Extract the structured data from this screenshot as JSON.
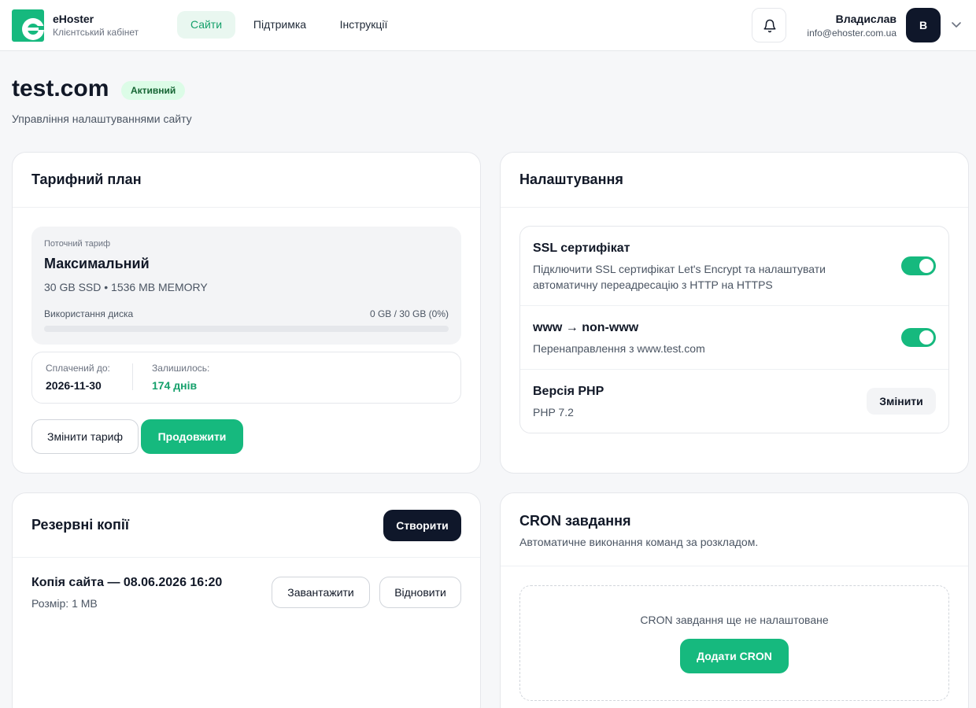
{
  "brand": {
    "name": "eHoster",
    "subtitle": "Клієнтський кабінет"
  },
  "nav": [
    {
      "label": "Сайти",
      "active": true
    },
    {
      "label": "Підтримка",
      "active": false
    },
    {
      "label": "Інструкції",
      "active": false
    }
  ],
  "user": {
    "name": "Владислав",
    "email": "info@ehoster.com.ua",
    "initial": "В"
  },
  "page": {
    "title": "test.com",
    "status": "Активний",
    "subtitle": "Управління налаштуваннями сайту"
  },
  "tariff": {
    "title": "Тарифний план",
    "current_label": "Поточний тариф",
    "plan_name": "Максимальний",
    "specs": "30 GB SSD • 1536 MB MEMORY",
    "disk_label": "Використання диска",
    "disk_value": "0 GB / 30 GB (0%)",
    "disk_usage_fraction": 0,
    "paid_label": "Сплачений до:",
    "paid_value": "2026-11-30",
    "left_label": "Залишилось:",
    "left_value": "174 днів",
    "change_button": "Змінити тариф",
    "extend_button": "Продовжити"
  },
  "settings": {
    "title": "Налаштування",
    "ssl": {
      "title": "SSL сертифікат",
      "desc": "Підключити SSL сертифікат Let's Encrypt та налаштувати автоматичну переадресацію з HTTP на HTTPS",
      "enabled": true
    },
    "www": {
      "title": "www → non-www",
      "desc": "Перенаправлення з www.test.com",
      "enabled": true
    },
    "php": {
      "title": "Версія PHP",
      "value": "PHP 7.2",
      "button": "Змінити"
    }
  },
  "backups": {
    "title": "Резервні копії",
    "create_button": "Створити",
    "items": [
      {
        "name": "Копія сайта — 08.06.2026 16:20",
        "size": "Розмір: 1 MB",
        "download": "Завантажити",
        "restore": "Відновити"
      }
    ]
  },
  "cron": {
    "title": "CRON завдання",
    "desc": "Автоматичне виконання команд за розкладом.",
    "empty": "CRON завдання ще не налаштоване",
    "add_button": "Додати CRON"
  },
  "colors": {
    "accent": "#16b97e",
    "dark": "#0f172a",
    "badge_bg": "#dcfce7",
    "badge_text": "#166534"
  }
}
